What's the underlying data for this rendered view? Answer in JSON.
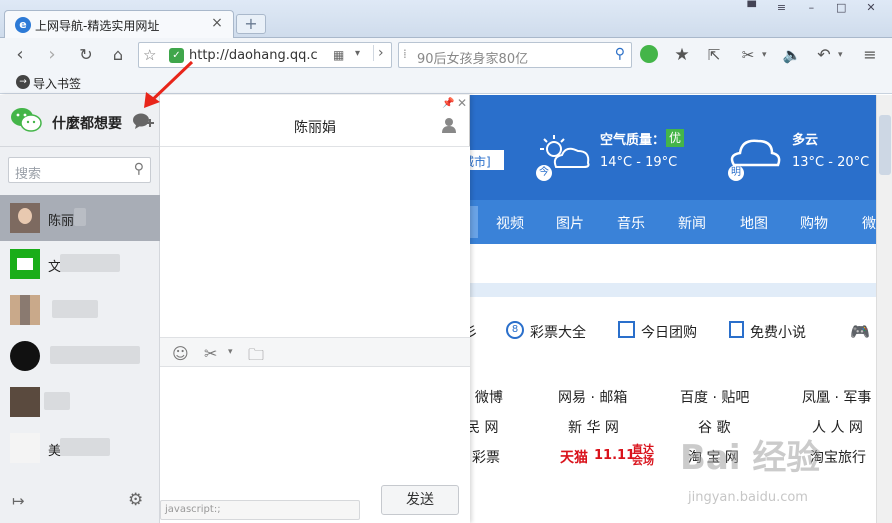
{
  "browser": {
    "tab_title": "上网导航-精选实用网址",
    "url": "http://daohang.qq.c",
    "search_placeholder": "90后女孩身家80亿",
    "bookmark_label": "导入书签",
    "new_tab_label": "+"
  },
  "chat": {
    "brand": "什麼都想要",
    "search_placeholder": "搜索",
    "conversation_title": "陈丽娟",
    "send_label": "发送",
    "status_text": "javascript:;",
    "contacts": [
      {
        "name": "陈丽",
        "active": true
      },
      {
        "name": "文",
        "active": false
      },
      {
        "name": "",
        "active": false
      },
      {
        "name": "",
        "active": false
      },
      {
        "name": "",
        "active": false
      },
      {
        "name": "美",
        "active": false
      }
    ]
  },
  "webpage": {
    "weather_today_label": "空气质量：",
    "aqi_badge": "优",
    "today_temp": "14°C - 19°C",
    "today_tag": "今",
    "tomorrow_label": "多云",
    "tomorrow_temp": "13°C - 20°C",
    "tomorrow_tag": "明",
    "city_fragment": "城市]",
    "nav": [
      "视频",
      "图片",
      "音乐",
      "新闻",
      "地图",
      "购物",
      "微"
    ],
    "services": [
      "彩票大全",
      "今日团购",
      "免费小说"
    ],
    "links_row1": [
      "· 微博",
      "网易 · 邮箱",
      "百度 · 贴吧",
      "凤凰 · 军事"
    ],
    "links_row2": [
      "民 网",
      "新 华 网",
      "谷 歌",
      "人 人 网"
    ],
    "links_row3": [
      "彩票",
      "天猫",
      "淘 宝 网",
      "淘宝旅行"
    ],
    "tmall_promo": "直达会场",
    "tmall_date": "11.11"
  },
  "watermark": {
    "text": "Bai 经验",
    "url": "jingyan.baidu.com"
  },
  "colors": {
    "accent_blue": "#2a6fcb",
    "wechat_green": "#44b549",
    "tmall_red": "#d9121b"
  }
}
